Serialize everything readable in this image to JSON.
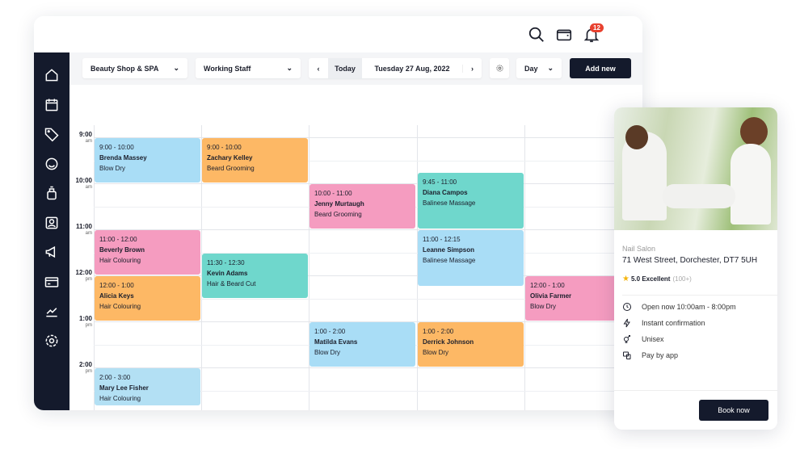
{
  "header": {
    "notifications": "12",
    "icons": [
      "search-icon",
      "wallet-icon",
      "bell-icon"
    ]
  },
  "sidebar": {
    "icons": [
      "home-icon",
      "calendar-icon",
      "tag-icon",
      "smiley-icon",
      "product-icon",
      "contact-card-icon",
      "megaphone-icon",
      "credit-card-icon",
      "chart-icon",
      "gear-icon"
    ]
  },
  "toolbar": {
    "shop": "Beauty Shop & SPA",
    "staff": "Working Staff",
    "today": "Today",
    "date": "Tuesday 27 Aug, 2022",
    "view": "Day",
    "add_new": "Add new"
  },
  "times": [
    {
      "h": "9:00",
      "p": "am"
    },
    {
      "h": "10:00",
      "p": "am"
    },
    {
      "h": "11:00",
      "p": "am"
    },
    {
      "h": "12:00",
      "p": "pm"
    },
    {
      "h": "1:00",
      "p": "pm"
    },
    {
      "h": "2:00",
      "p": "pm"
    }
  ],
  "colors": {
    "blue": "#a9ddf6",
    "orange": "#fdb865",
    "pink": "#f59cc0",
    "teal": "#6fd7cc",
    "lightblue": "#b3e0f4",
    "navy": "#141a2c"
  },
  "events": [
    {
      "col": 0,
      "start": 9,
      "end": 10,
      "time": "9:00 - 10:00",
      "name": "Brenda Massey",
      "service": "Blow Dry",
      "color": "blue"
    },
    {
      "col": 0,
      "start": 11,
      "end": 12,
      "time": "11:00 - 12:00",
      "name": "Beverly Brown",
      "service": "Hair Colouring",
      "color": "pink"
    },
    {
      "col": 0,
      "start": 12,
      "end": 13,
      "time": "12:00 - 1:00",
      "name": "Alicia Keys",
      "service": "Hair Colouring",
      "color": "orange"
    },
    {
      "col": 0,
      "start": 14,
      "end": 14.85,
      "time": "2:00 - 3:00",
      "name": "Mary Lee Fisher",
      "service": "Hair Colouring",
      "color": "lightblue"
    },
    {
      "col": 1,
      "start": 9,
      "end": 10,
      "time": "9:00 - 10:00",
      "name": "Zachary Kelley",
      "service": "Beard Grooming",
      "color": "orange"
    },
    {
      "col": 1,
      "start": 11.5,
      "end": 12.5,
      "time": "11:30 - 12:30",
      "name": "Kevin Adams",
      "service": "Hair & Beard Cut",
      "color": "teal"
    },
    {
      "col": 2,
      "start": 10,
      "end": 11,
      "time": "10:00 - 11:00",
      "name": "Jenny Murtaugh",
      "service": "Beard Grooming",
      "color": "pink"
    },
    {
      "col": 2,
      "start": 13,
      "end": 14,
      "time": "1:00 - 2:00",
      "name": "Matilda Evans",
      "service": "Blow Dry",
      "color": "blue"
    },
    {
      "col": 3,
      "start": 9.75,
      "end": 11,
      "time": "9:45 - 11:00",
      "name": "Diana Campos",
      "service": "Balinese Massage",
      "color": "teal"
    },
    {
      "col": 3,
      "start": 11,
      "end": 12.25,
      "time": "11:00 - 12:15",
      "name": "Leanne Simpson",
      "service": "Balinese Massage",
      "color": "blue"
    },
    {
      "col": 3,
      "start": 13,
      "end": 14,
      "time": "1:00 - 2:00",
      "name": "Derrick Johnson",
      "service": "Blow Dry",
      "color": "orange"
    },
    {
      "col": 4,
      "start": 12,
      "end": 13,
      "time": "12:00 - 1:00",
      "name": "Olivia Farmer",
      "service": "Blow Dry",
      "color": "pink"
    }
  ],
  "card": {
    "category": "Nail Salon",
    "address": "71 West Street, Dorchester, DT7 5UH",
    "rating": "5.0 Excellent",
    "reviews": "(100+)",
    "features": [
      {
        "icon": "clock-icon",
        "label": "Open now 10:00am - 8:00pm"
      },
      {
        "icon": "lightning-icon",
        "label": "Instant confirmation"
      },
      {
        "icon": "unisex-icon",
        "label": "Unisex"
      },
      {
        "icon": "pay-app-icon",
        "label": "Pay by app"
      }
    ],
    "book": "Book now"
  }
}
